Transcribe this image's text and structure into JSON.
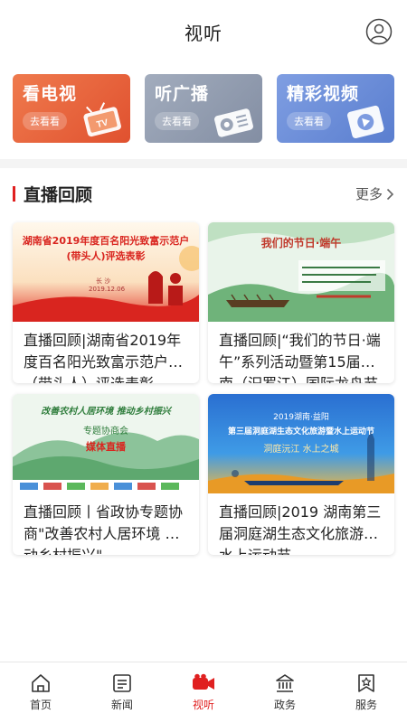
{
  "header": {
    "title": "视听"
  },
  "features": [
    {
      "title": "看电视",
      "sub": "去看看",
      "color": "#e8623a"
    },
    {
      "title": "听广播",
      "sub": "去看看",
      "color": "#8f9bb0"
    },
    {
      "title": "精彩视频",
      "sub": "去看看",
      "color": "#6d8fd8"
    }
  ],
  "section": {
    "title": "直播回顾",
    "more": "更多",
    "cards": [
      {
        "title": "直播回顾|湖南省2019年度百名阳光致富示范户（带头人）评选表彰",
        "thumb_text1": "湖南省2019年度百名阳光致富示范户",
        "thumb_text2": "(带头人)评选表彰",
        "thumb_text3": "长 沙",
        "thumb_text4": "2019.12.06"
      },
      {
        "title": "直播回顾|“我们的节日·端午”系列活动暨第15届湖南（汨罗江）国际龙舟节",
        "thumb_text1": "我们的节日·端午"
      },
      {
        "title": "直播回顾丨省政协专题协商\"改善农村人居环境 推动乡村振兴\"",
        "thumb_text1": "改善农村人居环境 推动乡村振兴",
        "thumb_text2": "专题协商会",
        "thumb_text3": "媒体直播"
      },
      {
        "title": "直播回顾|2019 湖南第三届洞庭湖生态文化旅游暨水上运动节",
        "thumb_text1": "2019湖南·益阳",
        "thumb_text2": "第三届洞庭湖生态文化旅游暨水上运动节",
        "thumb_text3": "洞庭沅江 水上之城"
      }
    ]
  },
  "nav": [
    {
      "label": "首页",
      "icon": "home-icon"
    },
    {
      "label": "新闻",
      "icon": "news-icon"
    },
    {
      "label": "视听",
      "icon": "video-icon",
      "active": true
    },
    {
      "label": "政务",
      "icon": "government-icon"
    },
    {
      "label": "服务",
      "icon": "service-icon"
    }
  ],
  "colors": {
    "accent": "#e02020"
  }
}
